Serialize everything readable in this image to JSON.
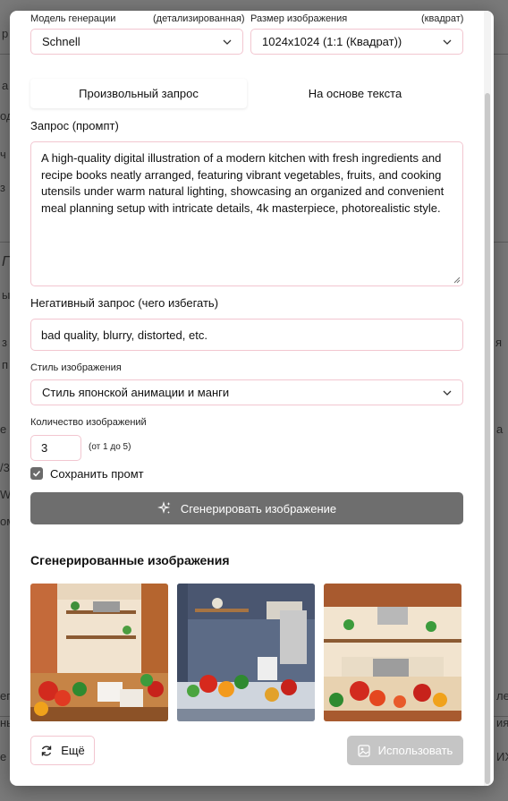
{
  "background_fragments": [
    "р",
    "а к",
    "од",
    "ч",
    "з",
    "Г",
    "ы",
    "з",
    "п",
    "я",
    "е и",
    "а",
    "/3.",
    "Wz",
    "ом",
    "ег",
    "ле",
    "ия",
    "нь",
    "е к",
    "ИХ"
  ],
  "model": {
    "label": "Модель генерации",
    "hint": "(детализированная)",
    "value": "Schnell"
  },
  "size": {
    "label": "Размер изображения",
    "hint": "(квадрат)",
    "value": "1024x1024 (1:1 (Квадрат))"
  },
  "tabs": [
    {
      "label": "Произвольный запрос",
      "active": true
    },
    {
      "label": "На основе текста",
      "active": false
    }
  ],
  "prompt": {
    "label": "Запрос (промпт)",
    "value": "A high-quality digital illustration of a modern kitchen with fresh ingredients and recipe books neatly arranged, featuring vibrant vegetables, fruits, and cooking utensils under warm natural lighting, showcasing an organized and convenient meal planning setup with intricate details, 4k masterpiece, photorealistic style."
  },
  "negative": {
    "label": "Негативный запрос (чего избегать)",
    "value": "bad quality, blurry, distorted, etc."
  },
  "style": {
    "label": "Стиль изображения",
    "value": "Стиль японской анимации и манги"
  },
  "count": {
    "label": "Количество изображений",
    "value": "3",
    "hint": "(от 1 до 5)"
  },
  "save_prompt": {
    "label": "Сохранить промт",
    "checked": true
  },
  "generate_button": "Сгенерировать изображение",
  "generated": {
    "title": "Сгенерированные изображения",
    "images": [
      "kitchen-image-1",
      "kitchen-image-2",
      "kitchen-image-3"
    ]
  },
  "more_button": "Ещё",
  "use_button": "Использовать",
  "colors": {
    "accent_border": "#f2c6d0",
    "generate_bg": "#6e6e6e",
    "use_bg_disabled": "#c5c5c5"
  }
}
